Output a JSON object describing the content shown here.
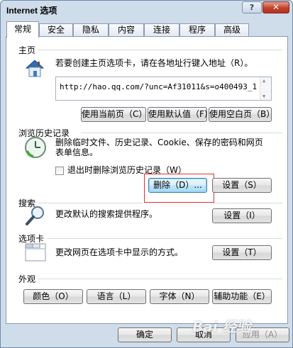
{
  "window": {
    "title": "Internet 选项"
  },
  "titlebar": {
    "help": "?",
    "close": "✕"
  },
  "tabs": [
    "常规",
    "安全",
    "隐私",
    "内容",
    "连接",
    "程序",
    "高级"
  ],
  "home": {
    "label": "主页",
    "description": "若要创建主页选项卡，请在各地址行键入地址（R）。",
    "url": "http://hao.qq.com/?unc=Af31011&s=o400493_1",
    "buttons": {
      "current": "使用当前页（C）",
      "default": "使用默认值（F）",
      "blank": "使用空白页（B）"
    }
  },
  "history": {
    "label": "浏览历史记录",
    "description_line1": "删除临时文件、历史记录、Cookie、保存的密码和网页",
    "description_line2": "表单信息。",
    "checkbox": "退出时删除浏览历史记录（W）",
    "delete_button": "删除（D）...",
    "settings_button": "设置（S）"
  },
  "search": {
    "label": "搜索",
    "description": "更改默认的搜索提供程序。",
    "settings_button": "设置（I）"
  },
  "tabs_section": {
    "label": "选项卡",
    "description": "更改网页在选项卡中显示的方式。",
    "settings_button": "设置（T）"
  },
  "appearance": {
    "label": "外观",
    "buttons": {
      "colors": "颜色（O）",
      "languages": "语言（L）",
      "fonts": "字体（N）",
      "accessibility": "辅助功能（E）"
    }
  },
  "footer": {
    "ok": "确定",
    "cancel": "取消",
    "apply": "应用（A）"
  },
  "watermark": "Bai 经验"
}
